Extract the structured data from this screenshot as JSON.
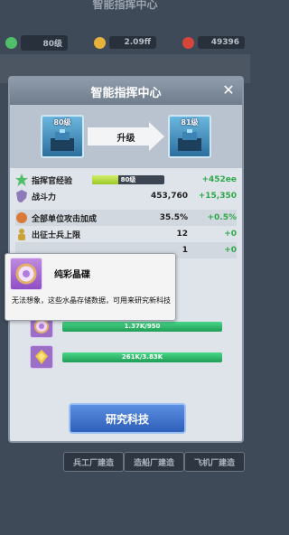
{
  "background": {
    "title": "智能指挥中心",
    "resources": [
      {
        "value": "80级",
        "color": "#4fbf6a",
        "icon": "star-icon"
      },
      {
        "value": "2.09ff",
        "color": "#e6b23a",
        "icon": "coin-icon"
      },
      {
        "value": "49396",
        "color": "#d8453a",
        "icon": "gem-icon"
      }
    ],
    "bottom_tabs": [
      "兵工厂建造",
      "造船厂建造",
      "飞机厂建造"
    ]
  },
  "modal": {
    "title": "智能指挥中心",
    "close_icon": "close-icon",
    "current_level": "80级",
    "next_level": "81级",
    "upgrade_label": "升级"
  },
  "stats": [
    {
      "name": "指挥官经验",
      "bar_text": "80级",
      "bar_fill_fraction": 0.36,
      "increase": "+452ee",
      "icon": "star-icon"
    },
    {
      "name": "战斗力",
      "value": "453,760",
      "increase": "+15,350",
      "icon": "shield-icon"
    },
    {
      "name": "全部单位攻击加成",
      "value": "35.5%",
      "increase": "+0.5%",
      "icon": "attack-icon"
    },
    {
      "name": "出征士兵上限",
      "value": "12",
      "increase": "+0",
      "icon": "soldier-icon"
    },
    {
      "name": "",
      "value": "1",
      "increase": "+0",
      "icon": ""
    }
  ],
  "resources": [
    {
      "value": "1.37K/950",
      "fill_fraction": 1.0,
      "icon": "crystal-disc-icon"
    },
    {
      "value": "261K/3.83K",
      "fill_fraction": 1.0,
      "icon": "gold-ingot-icon"
    }
  ],
  "research_button": "研究科技",
  "tooltip": {
    "name": "纯彩晶碟",
    "description": "无法想象，这些水晶存储数据，可用来研究新科技",
    "icon": "crystal-disc-icon"
  },
  "colors": {
    "modal_bg": "#dfe4ea",
    "header_bg": "#7f8c9c",
    "increase_green": "#2ea84a",
    "button_blue": "#3e72cf"
  }
}
